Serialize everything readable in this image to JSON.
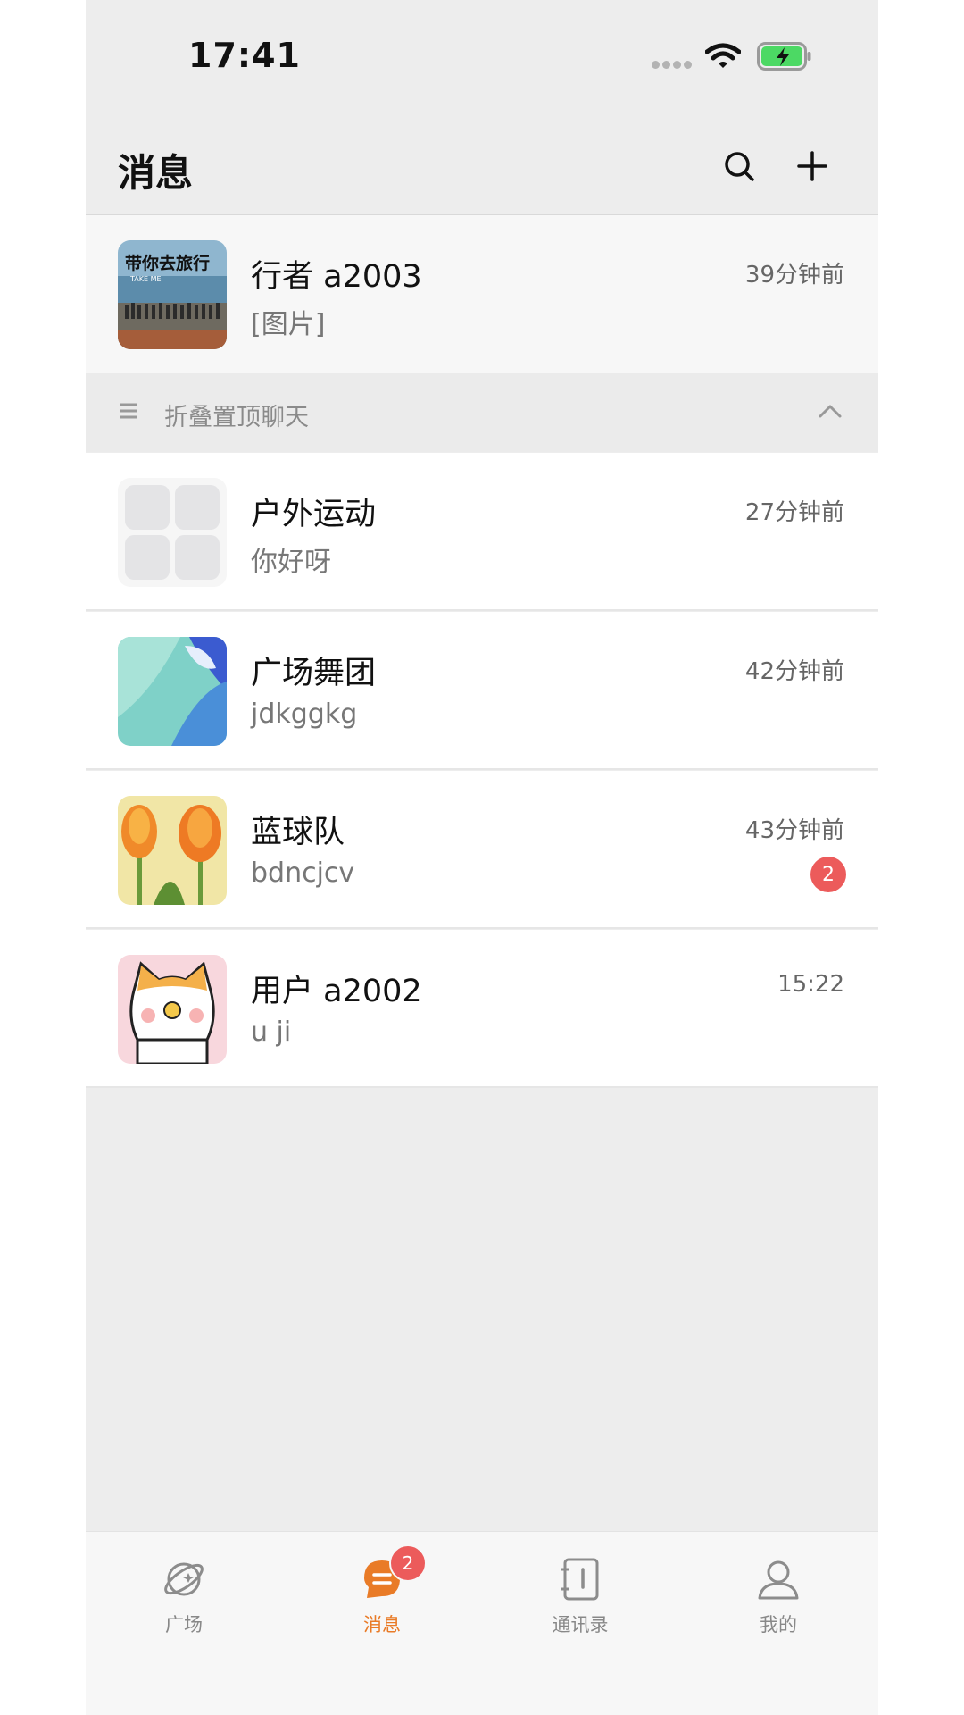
{
  "status_bar": {
    "time": "17:41"
  },
  "header": {
    "title": "消息"
  },
  "pinned": {
    "name": "行者 a2003",
    "preview": "[图片]",
    "time": "39分钟前",
    "avatar_text": "带你去旅行",
    "avatar_subtext": "TAKE ME"
  },
  "fold": {
    "label": "折叠置顶聊天"
  },
  "chats": [
    {
      "name": "户外运动",
      "preview": "你好呀",
      "time": "27分钟前"
    },
    {
      "name": "广场舞团",
      "preview": "jdkggkg",
      "time": "42分钟前"
    },
    {
      "name": "蓝球队",
      "preview": "bdncjcv",
      "time": "43分钟前",
      "unread": "2"
    },
    {
      "name": "用户 a2002",
      "preview": "u ji",
      "time": "15:22"
    }
  ],
  "tabs": [
    {
      "label": "广场",
      "icon": "planet-icon"
    },
    {
      "label": "消息",
      "icon": "chat-bubble-icon",
      "badge": "2"
    },
    {
      "label": "通讯录",
      "icon": "contacts-book-icon"
    },
    {
      "label": "我的",
      "icon": "person-icon"
    }
  ],
  "colors": {
    "accent": "#e97b27",
    "badge": "#ec5b5b",
    "battery": "#4cd964"
  }
}
